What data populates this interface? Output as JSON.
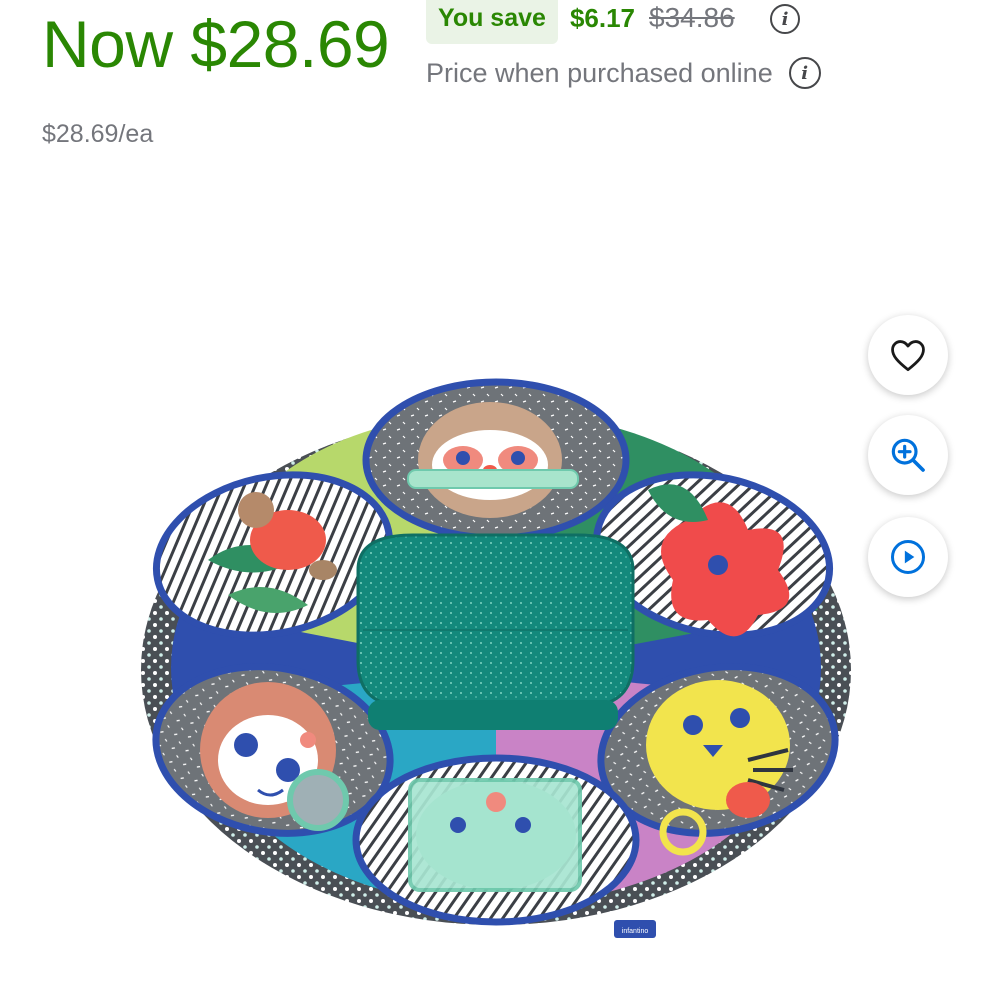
{
  "price": {
    "current": "Now $28.69",
    "you_save_label": "You save",
    "save_amount": "$6.17",
    "was_price": "$34.86",
    "online_note": "Price when purchased online",
    "unit_price": "$28.69/ea"
  },
  "actions": {
    "favorite_icon": "heart-icon",
    "zoom_icon": "zoom-in-icon",
    "video_icon": "play-icon"
  },
  "product_image": {
    "brand_tag": "infantino"
  },
  "colors": {
    "price_green": "#2a8703",
    "save_badge_bg": "#eaf3e6",
    "muted_text": "#74767c",
    "action_blue": "#0071dc"
  }
}
